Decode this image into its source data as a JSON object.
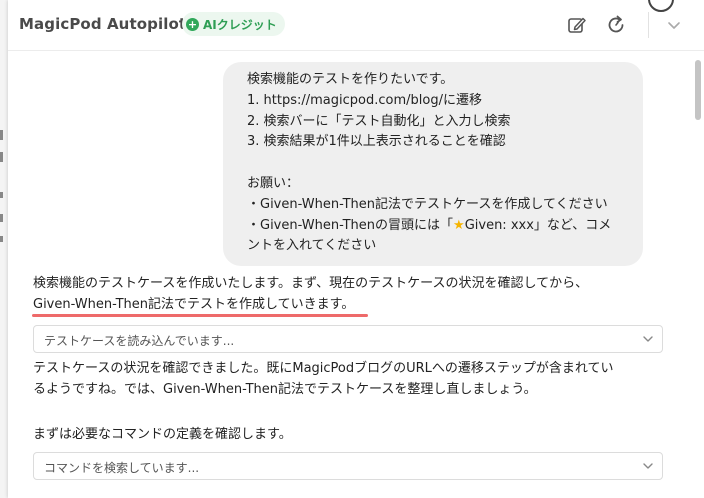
{
  "header": {
    "title": "MagicPod Autopilot",
    "badge_label": "AIクレジット"
  },
  "user_message": {
    "lines": [
      "検索機能のテストを作りたいです。",
      "1. https://magicpod.com/blog/に遷移",
      "2. 検索バーに「テスト自動化」と入力し検索",
      "3. 検索結果が1件以上表示されることを確認",
      "",
      "お願い：",
      "・Given-When-Then記法でテストケースを作成してください",
      "・Given-When-Thenの冒頭には「",
      "Given: xxx」など、コメ",
      "ントを入れてください"
    ]
  },
  "assistant_messages": [
    {
      "lines": [
        "検索機能のテストケースを作成いたします。まず、現在のテストケースの状況を確認してから、",
        "Given-When-Then記法でテストを作成していきます。"
      ]
    },
    {
      "lines": [
        "テストケースの状況を確認できました。既にMagicPodブログのURLへの遷移ステップが含まれてい",
        "るようですね。では、Given-When-Then記法でテストケースを整理し直しましょう。"
      ]
    },
    {
      "lines": [
        "まずは必要なコマンドの定義を確認します。"
      ]
    }
  ],
  "status_items": [
    {
      "label": "テストケースを読み込んでいます..."
    },
    {
      "label": "コマンドを検索しています..."
    }
  ],
  "icons": {
    "badge": "credit-icon",
    "edit": "edit-icon",
    "refresh": "refresh-icon",
    "collapse": "chevron-down-icon",
    "star": "star-icon"
  },
  "colors": {
    "badge_green": "#30a85a",
    "highlight_red": "#ee6a6a",
    "bubble_bg": "#efefef"
  }
}
